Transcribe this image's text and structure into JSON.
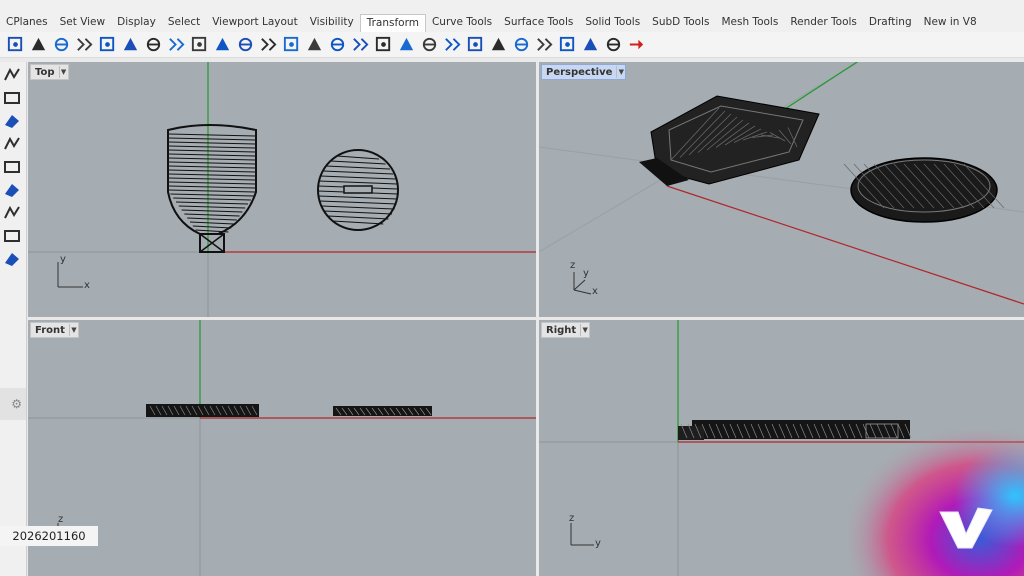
{
  "tabs": [
    "CPlanes",
    "Set View",
    "Display",
    "Select",
    "Viewport Layout",
    "Visibility",
    "Transform",
    "Curve Tools",
    "Surface Tools",
    "Solid Tools",
    "SubD Tools",
    "Mesh Tools",
    "Render Tools",
    "Drafting",
    "New in V8"
  ],
  "active_tab": "Transform",
  "toolbar_icons": [
    "move-icon",
    "copy-icon",
    "rotate-icon",
    "scale-icon",
    "mirror-icon",
    "orient-icon",
    "array-icon",
    "array-polar-icon",
    "array-curve-icon",
    "flow-icon",
    "twist-icon",
    "bend-icon",
    "taper-icon",
    "smooth-icon",
    "cage-edit-icon",
    "align-icon",
    "distribute-icon",
    "set-points-icon",
    "project-icon",
    "stretch-icon",
    "shear-icon",
    "splop-icon",
    "flow-surface-icon",
    "maelstrom-icon",
    "sporph-icon",
    "box-edit-icon",
    "gumball-icon",
    "more-arrow-icon"
  ],
  "sidebar_icons": [
    "move-curve-icon",
    "rectangle-icon",
    "surface-icon",
    "plane-icon",
    "extrude-icon",
    "fillet-icon",
    "boolean-icon",
    "transform-icon",
    "solid-icon"
  ],
  "viewports": {
    "top": {
      "label": "Top",
      "axis_a": "y",
      "axis_b": "x"
    },
    "perspective": {
      "label": "Perspective",
      "axis_a": "z",
      "axis_b": "y",
      "axis_c": "x"
    },
    "front": {
      "label": "Front",
      "axis_a": "z"
    },
    "right": {
      "label": "Right",
      "axis_a": "z",
      "axis_b": "y"
    }
  },
  "stamp_text": "2026201160",
  "colors": {
    "viewport_bg": "#a5acb2",
    "x_axis": "#b0262a",
    "y_axis": "#1f9a2c",
    "selected_label": "#c9d8f2"
  }
}
